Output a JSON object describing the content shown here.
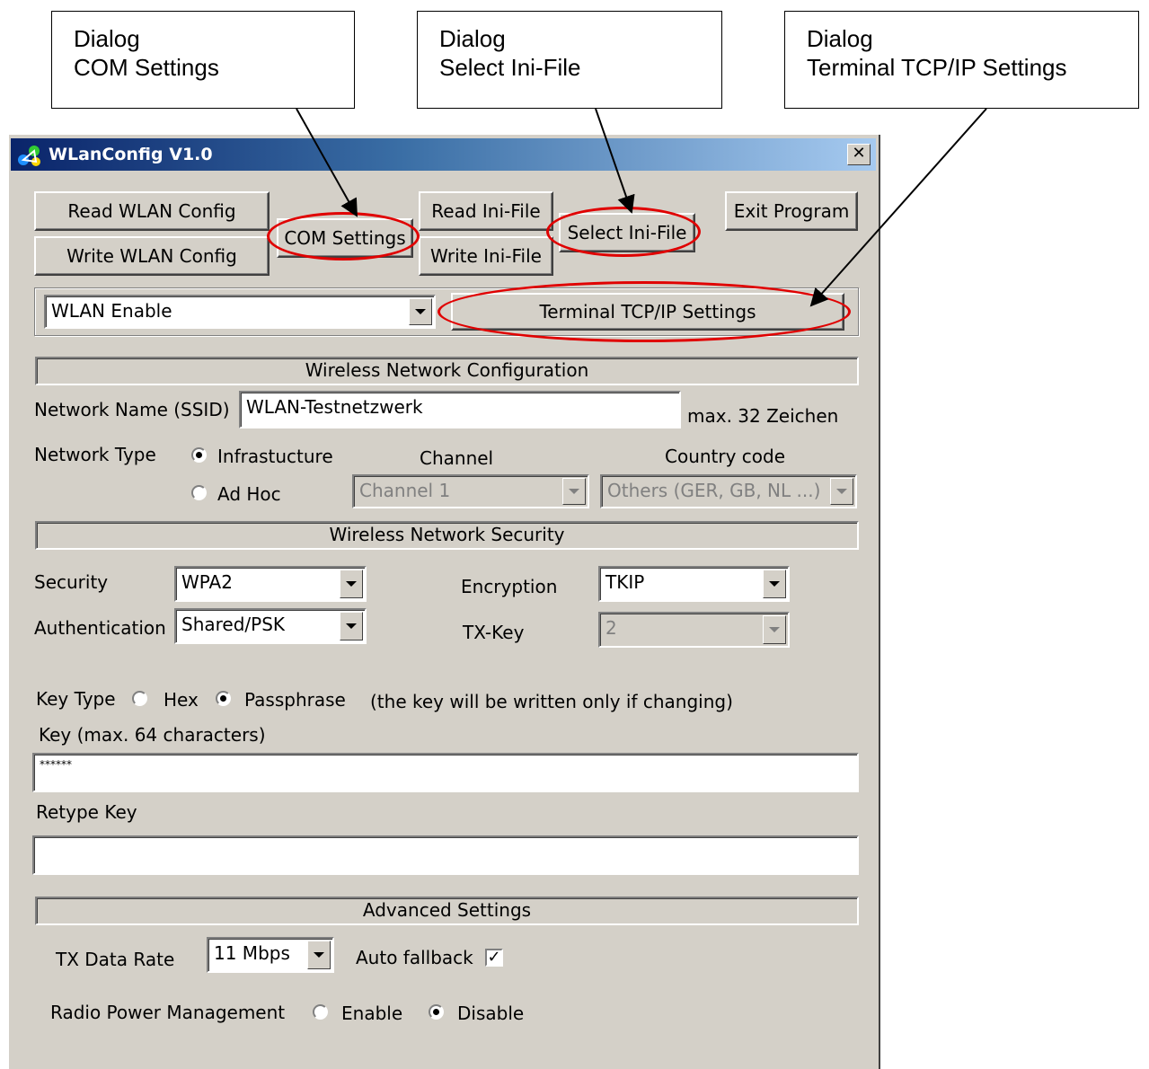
{
  "callouts": [
    {
      "line1": "Dialog",
      "line2": "COM Settings"
    },
    {
      "line1": "Dialog",
      "line2": "Select Ini-File"
    },
    {
      "line1": "Dialog",
      "line2": "Terminal TCP/IP Settings"
    }
  ],
  "window": {
    "title": "WLanConfig V1.0",
    "close_label": "✕"
  },
  "toolbar": {
    "read_wlan": "Read WLAN Config",
    "write_wlan": "Write WLAN Config",
    "com_settings": "COM Settings",
    "read_ini": "Read Ini-File",
    "write_ini": "Write Ini-File",
    "select_ini": "Select Ini-File",
    "exit": "Exit Program"
  },
  "wlan_mode": {
    "selected": "WLAN Enable"
  },
  "terminal_button": "Terminal TCP/IP Settings",
  "wireless_config": {
    "header": "Wireless Network Configuration",
    "ssid_label": "Network Name (SSID)",
    "ssid_value": "WLAN-Testnetzwerk",
    "ssid_hint": "max. 32 Zeichen",
    "network_type_label": "Network Type",
    "infrastructure_label": "Infrastucture",
    "adhoc_label": "Ad Hoc",
    "network_type_selected": "Infrastucture",
    "channel_label": "Channel",
    "channel_value": "Channel 1",
    "country_label": "Country code",
    "country_value": "Others (GER, GB, NL ...)"
  },
  "security": {
    "header": "Wireless Network Security",
    "security_label": "Security",
    "security_value": "WPA2",
    "auth_label": "Authentication",
    "auth_value": "Shared/PSK",
    "encryption_label": "Encryption",
    "encryption_value": "TKIP",
    "txkey_label": "TX-Key",
    "txkey_value": "2",
    "key_type_label": "Key Type",
    "hex_label": "Hex",
    "passphrase_label": "Passphrase",
    "key_type_selected": "Passphrase",
    "key_note": "(the key will be written only if changing)",
    "key_label": "Key (max. 64 characters)",
    "key_value": "******",
    "retype_label": "Retype Key",
    "retype_value": ""
  },
  "advanced": {
    "header": "Advanced Settings",
    "tx_rate_label": "TX Data Rate",
    "tx_rate_value": "11 Mbps",
    "fallback_label": "Auto fallback",
    "fallback_checked": true,
    "radio_pm_label": "Radio Power Management",
    "enable_label": "Enable",
    "disable_label": "Disable",
    "radio_pm_selected": "Disable"
  },
  "colors": {
    "highlight": "#e00000",
    "titlebar_start": "#0a246a",
    "face": "#d4d0c8"
  }
}
